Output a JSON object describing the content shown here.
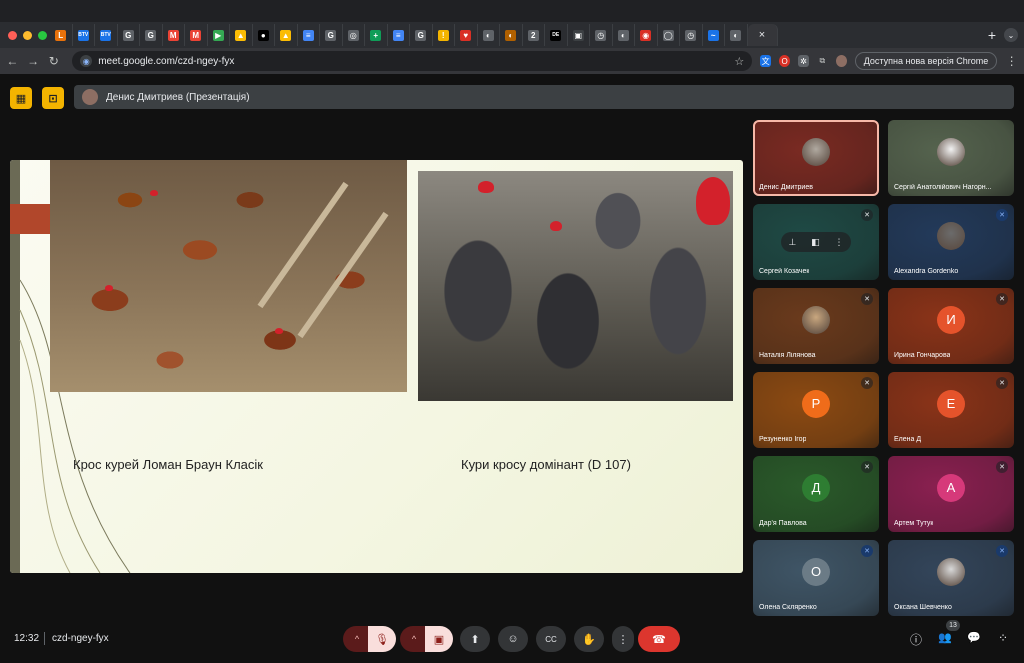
{
  "browser": {
    "tab_favicons": [
      {
        "glyph": "L",
        "color": "#e8710a"
      },
      {
        "glyph": "BTV",
        "color": "#1a73e8"
      },
      {
        "glyph": "BTV",
        "color": "#1a73e8"
      },
      {
        "glyph": "G",
        "color": "#5f6368"
      },
      {
        "glyph": "G",
        "color": "#5f6368"
      },
      {
        "glyph": "M",
        "color": "#ea4335"
      },
      {
        "glyph": "M",
        "color": "#ea4335"
      },
      {
        "glyph": "▶",
        "color": "#34a853"
      },
      {
        "glyph": "▲",
        "color": "#fbbc04"
      },
      {
        "glyph": "●",
        "color": "#000000"
      },
      {
        "glyph": "▲",
        "color": "#fbbc04"
      },
      {
        "glyph": "≡",
        "color": "#4285f4"
      },
      {
        "glyph": "G",
        "color": "#5f6368"
      },
      {
        "glyph": "◎",
        "color": "#5f6368"
      },
      {
        "glyph": "+",
        "color": "#0f9d58"
      },
      {
        "glyph": "≡",
        "color": "#4285f4"
      },
      {
        "glyph": "G",
        "color": "#5f6368"
      },
      {
        "glyph": "!",
        "color": "#f4b400"
      },
      {
        "glyph": "♥",
        "color": "#d93025"
      },
      {
        "glyph": "◐",
        "color": "#5f6368"
      },
      {
        "glyph": "◐",
        "color": "#b06000"
      },
      {
        "glyph": "2",
        "color": "#5f6368"
      },
      {
        "glyph": "DE",
        "color": "#000000"
      },
      {
        "glyph": "▣",
        "color": "#3c4043"
      },
      {
        "glyph": "◷",
        "color": "#5f6368"
      },
      {
        "glyph": "◐",
        "color": "#5f6368"
      },
      {
        "glyph": "◉",
        "color": "#d93025"
      },
      {
        "glyph": "◯",
        "color": "#5f6368"
      },
      {
        "glyph": "◷",
        "color": "#5f6368"
      },
      {
        "glyph": "~",
        "color": "#1a73e8"
      },
      {
        "glyph": "◐",
        "color": "#5f6368"
      }
    ],
    "active_tab_close": "×",
    "new_tab": "+",
    "url": "meet.google.com/czd-ngey-fyx",
    "update_label": "Доступна нова версія Chrome"
  },
  "meet": {
    "presenter_label": "Денис Дмитриев (Презентація)",
    "time": "12:32",
    "meeting_code": "czd-ngey-fyx",
    "participants_badge": "13"
  },
  "slide": {
    "caption_left": "Крос курей Ломан Браун Класік",
    "caption_right": "Кури кросу домінант (D 107)"
  },
  "participants": [
    {
      "name": "Денис Дмитриев",
      "bg": "#7a2a22",
      "mic": "none",
      "avatar": "photo",
      "avatar_color": "#b0a9a0",
      "highlight": true
    },
    {
      "name": "Сергій Анатолійович Нагорн...",
      "bg": "#55634e",
      "mic": "none",
      "avatar": "photo",
      "avatar_color": "#f2f2f2",
      "highlight": false
    },
    {
      "name": "Сергей Козачек",
      "bg": "#1f4a45",
      "mic": "muted",
      "avatar": "hover",
      "avatar_color": "",
      "highlight": false
    },
    {
      "name": "Alexandra Gordenko",
      "bg": "#233a5a",
      "mic": "speaking",
      "avatar": "photo",
      "avatar_color": "#6b6b6b",
      "highlight": false
    },
    {
      "name": "Наталія Лілянова",
      "bg": "#6a3a1c",
      "mic": "muted",
      "avatar": "photo",
      "avatar_color": "#c9a77f",
      "highlight": false
    },
    {
      "name": "Ирина Гончарова",
      "bg": "#8a3318",
      "mic": "muted",
      "avatar": "letter",
      "letter": "И",
      "avatar_color": "#e5532b",
      "highlight": false
    },
    {
      "name": "Резуненко Ігор",
      "bg": "#8c4a12",
      "mic": "muted",
      "avatar": "letter",
      "letter": "Р",
      "avatar_color": "#ef6c1a",
      "highlight": false
    },
    {
      "name": "Елена Д",
      "bg": "#8a3318",
      "mic": "muted",
      "avatar": "letter",
      "letter": "Е",
      "avatar_color": "#e5532b",
      "highlight": false
    },
    {
      "name": "Дар'я Павлова",
      "bg": "#2a5a2a",
      "mic": "muted",
      "avatar": "letter",
      "letter": "Д",
      "avatar_color": "#2e7d32",
      "highlight": false
    },
    {
      "name": "Артем Тутук",
      "bg": "#8a2050",
      "mic": "muted",
      "avatar": "letter",
      "letter": "А",
      "avatar_color": "#d6397a",
      "highlight": false
    },
    {
      "name": "Олена Скляренко",
      "bg": "#3f5566",
      "mic": "speaking",
      "avatar": "letter",
      "letter": "О",
      "avatar_color": "#6b7b86",
      "highlight": false
    },
    {
      "name": "Оксана Шевченко",
      "bg": "#33455a",
      "mic": "speaking",
      "avatar": "photo",
      "avatar_color": "#d8d8d8",
      "highlight": false
    }
  ],
  "icons": {
    "mic_muted": "🎙",
    "hand": "✋",
    "emoji": "☺",
    "cc": "CC",
    "present": "⬆",
    "end_call": "☎",
    "more": "⋮",
    "info": "ⓘ",
    "people": "👥",
    "chat": "💬",
    "apps": "⁘"
  }
}
